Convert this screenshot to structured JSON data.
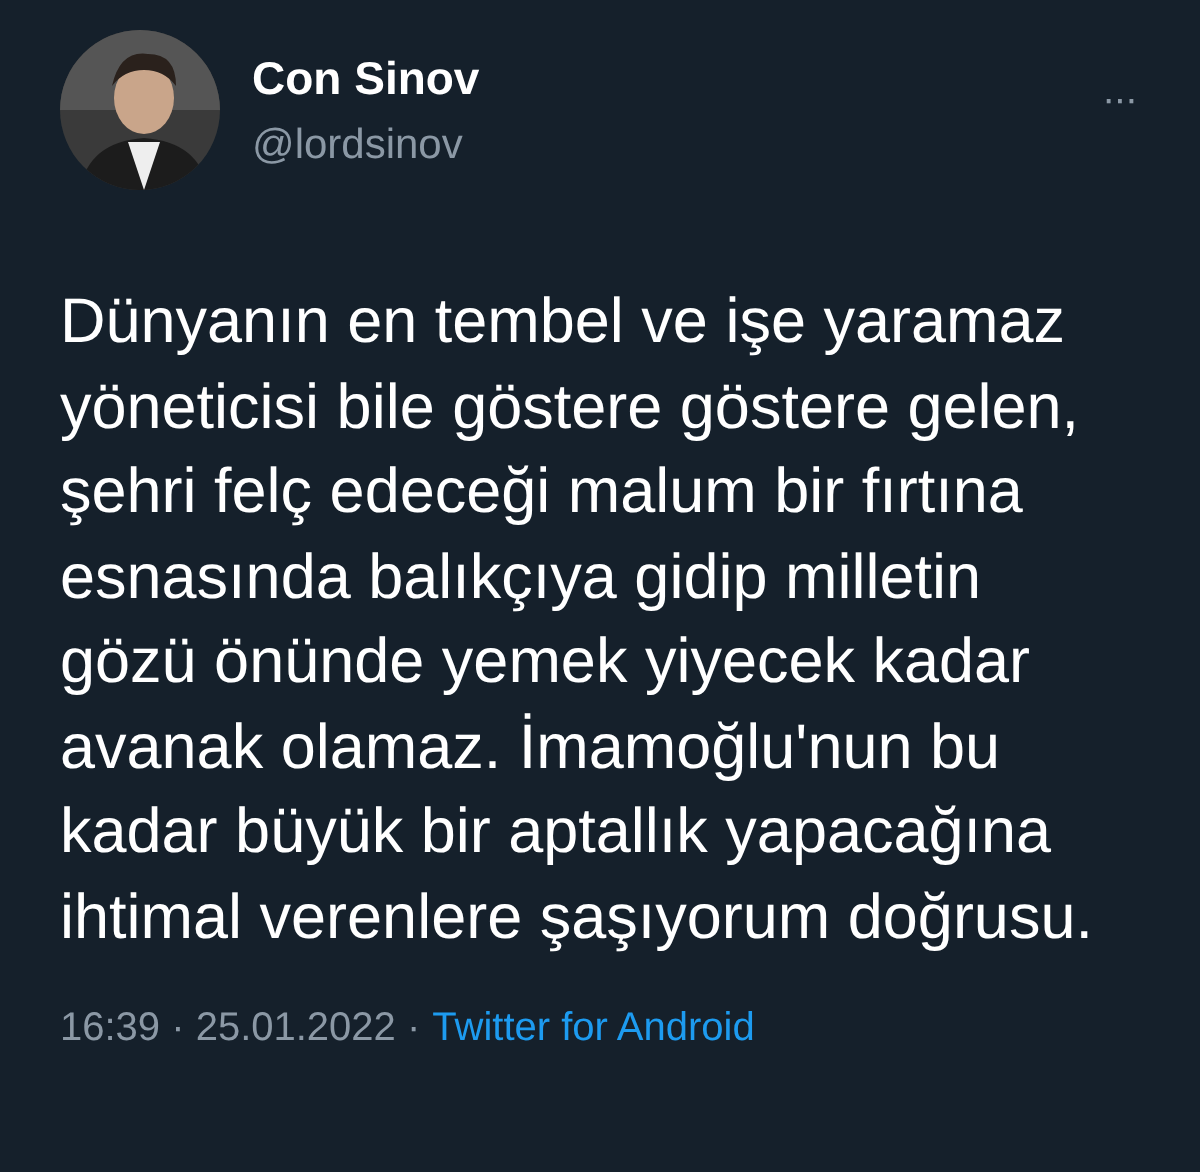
{
  "tweet": {
    "author": {
      "name": "Con Sinov",
      "handle": "@lordsinov"
    },
    "menu": "···",
    "text": "Dünyanın en tembel ve işe yaramaz\nyöneticisi bile göstere göstere gelen,\nşehri felç edeceği malum bir fırtına\nesnasında balıkçıya gidip milletin\ngözü önünde yemek yiyecek kadar\navanak olamaz. İmamoğlu'nun bu\nkadar büyük bir aptallık yapacağına\nihtimal verenlere şaşıyorum doğrusu.",
    "meta": "16:39 · 25.01.2022 ·",
    "source": "Twitter for Android"
  }
}
